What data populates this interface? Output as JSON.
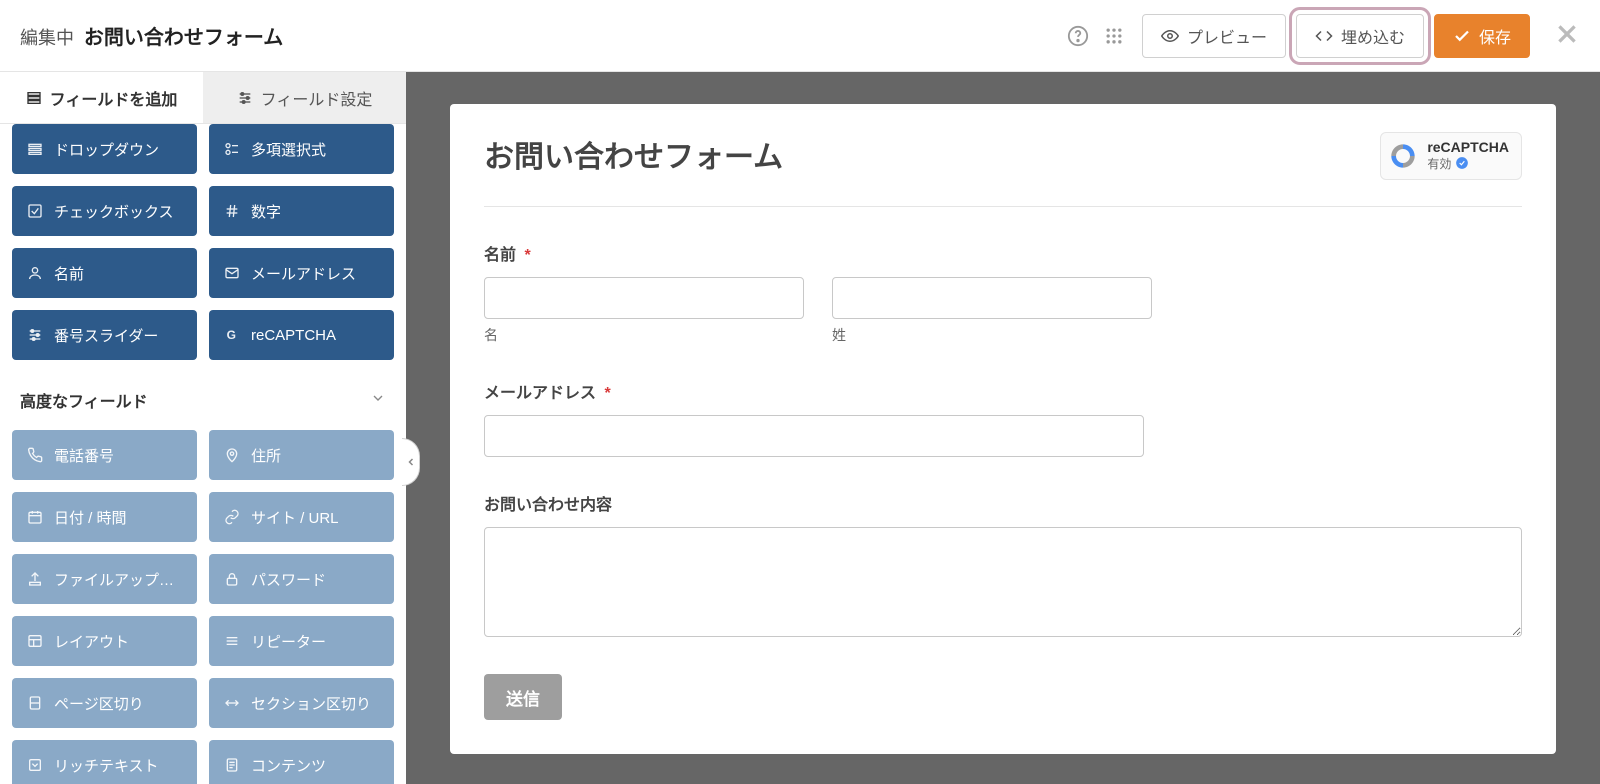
{
  "header": {
    "editing_label": "編集中",
    "form_name": "お問い合わせフォーム",
    "preview_label": "プレビュー",
    "embed_label": "埋め込む",
    "save_label": "保存"
  },
  "sidebar": {
    "tab_add_label": "フィールドを追加",
    "tab_settings_label": "フィールド設定",
    "basic_fields": [
      {
        "label": "ドロップダウン",
        "icon": "list"
      },
      {
        "label": "多項選択式",
        "icon": "radio"
      },
      {
        "label": "チェックボックス",
        "icon": "check"
      },
      {
        "label": "数字",
        "icon": "hash"
      },
      {
        "label": "名前",
        "icon": "user"
      },
      {
        "label": "メールアドレス",
        "icon": "mail"
      },
      {
        "label": "番号スライダー",
        "icon": "sliders"
      },
      {
        "label": "reCAPTCHA",
        "icon": "g"
      }
    ],
    "advanced_title": "高度なフィールド",
    "advanced_fields": [
      {
        "label": "電話番号",
        "icon": "phone"
      },
      {
        "label": "住所",
        "icon": "pin"
      },
      {
        "label": "日付 / 時間",
        "icon": "calendar"
      },
      {
        "label": "サイト / URL",
        "icon": "link"
      },
      {
        "label": "ファイルアップロ...",
        "icon": "upload"
      },
      {
        "label": "パスワード",
        "icon": "lock"
      },
      {
        "label": "レイアウト",
        "icon": "layout"
      },
      {
        "label": "リピーター",
        "icon": "repeat"
      },
      {
        "label": "ページ区切り",
        "icon": "page"
      },
      {
        "label": "セクション区切り",
        "icon": "section"
      },
      {
        "label": "リッチテキスト",
        "icon": "rich"
      },
      {
        "label": "コンテンツ",
        "icon": "content"
      }
    ]
  },
  "form": {
    "title": "お問い合わせフォーム",
    "recaptcha_title": "reCAPTCHA",
    "recaptcha_status": "有効",
    "name_label": "名前",
    "name_first_sub": "名",
    "name_last_sub": "姓",
    "email_label": "メールアドレス",
    "message_label": "お問い合わせ内容",
    "submit_label": "送信",
    "required_marker": "*"
  }
}
